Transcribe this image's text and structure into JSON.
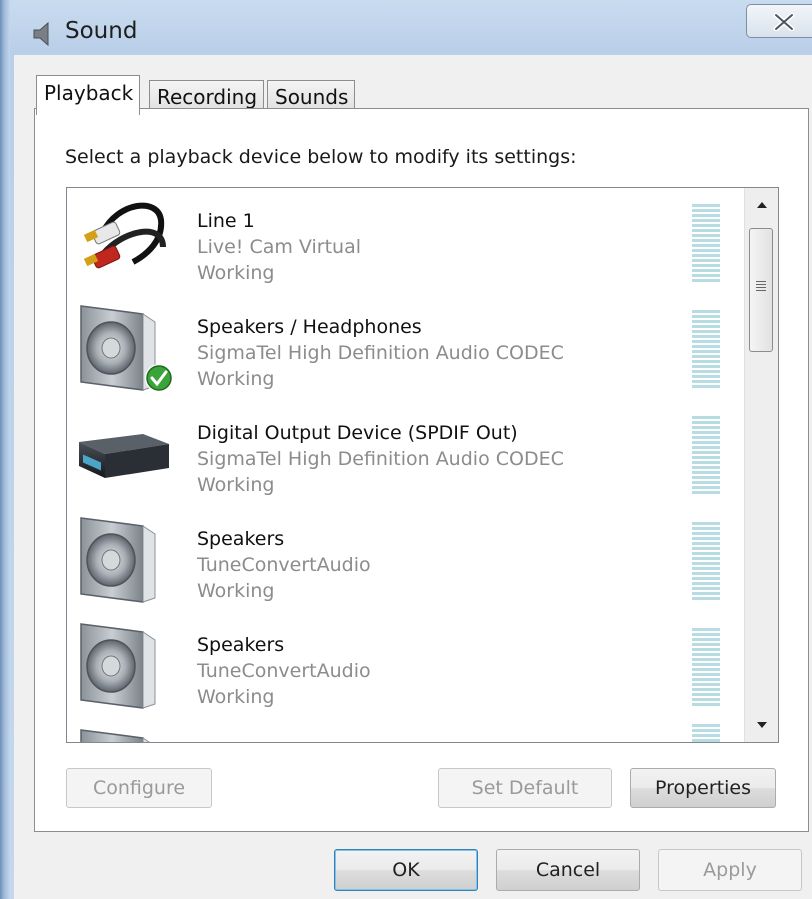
{
  "window": {
    "title": "Sound"
  },
  "tabs": [
    {
      "label": "Playback",
      "active": true
    },
    {
      "label": "Recording",
      "active": false
    },
    {
      "label": "Sounds",
      "active": false
    }
  ],
  "instruction": "Select a playback device below to modify its settings:",
  "devices": [
    {
      "name": "Line 1",
      "driver": "Live! Cam Virtual",
      "status": "Working",
      "icon": "rca-cable-icon",
      "default": false
    },
    {
      "name": "Speakers / Headphones",
      "driver": "SigmaTel High Definition Audio CODEC",
      "status": "Working",
      "icon": "speaker-icon",
      "default": true
    },
    {
      "name": "Digital Output Device (SPDIF Out)",
      "driver": "SigmaTel High Definition Audio CODEC",
      "status": "Working",
      "icon": "receiver-icon",
      "default": false
    },
    {
      "name": "Speakers",
      "driver": "TuneConvertAudio",
      "status": "Working",
      "icon": "speaker-icon",
      "default": false
    },
    {
      "name": "Speakers",
      "driver": "TuneConvertAudio",
      "status": "Working",
      "icon": "speaker-icon",
      "default": false
    }
  ],
  "buttons": {
    "configure": "Configure",
    "set_default": "Set Default",
    "properties": "Properties",
    "ok": "OK",
    "cancel": "Cancel",
    "apply": "Apply"
  },
  "colors": {
    "level_meter": "#b8dce3",
    "default_check": "#3aa43a"
  }
}
